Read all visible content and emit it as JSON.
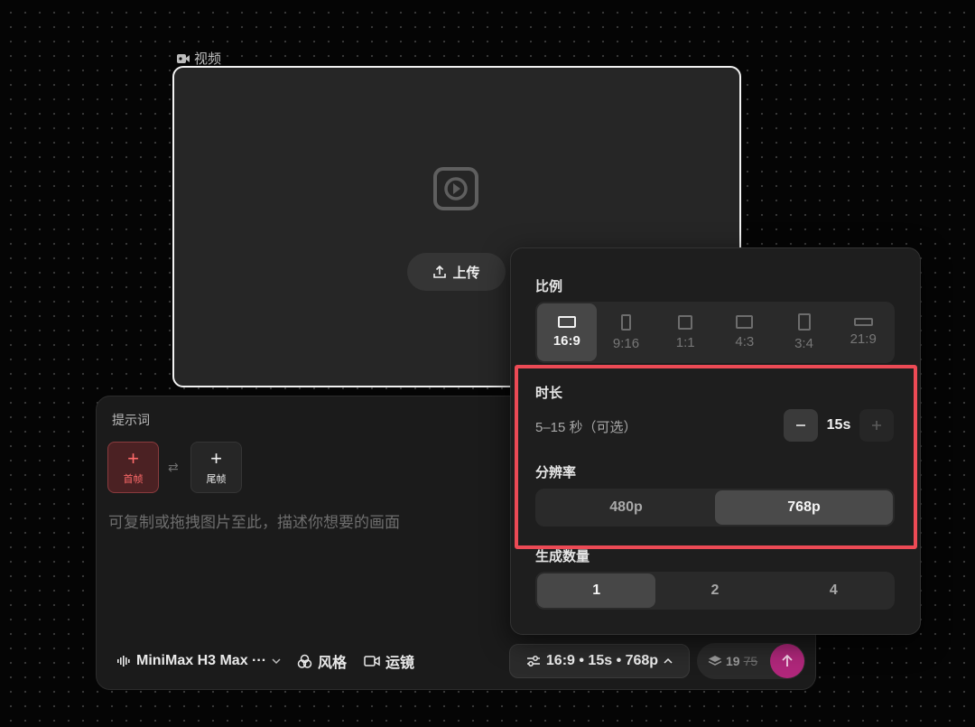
{
  "video": {
    "label": "视频",
    "upload_label": "上传"
  },
  "prompt": {
    "title": "提示词",
    "first_frame": "首帧",
    "last_frame": "尾帧",
    "placeholder": "可复制或拖拽图片至此，描述你想要的画面",
    "model": "MiniMax H3 Max ···",
    "style": "风格",
    "camera": "运镜",
    "settings_summary": "16:9 • 15s • 768p",
    "credits": "19",
    "credits_original": "75"
  },
  "settings": {
    "ratio_title": "比例",
    "ratios": [
      {
        "label": "16:9",
        "active": true
      },
      {
        "label": "9:16",
        "active": false
      },
      {
        "label": "1:1",
        "active": false
      },
      {
        "label": "4:3",
        "active": false
      },
      {
        "label": "3:4",
        "active": false
      },
      {
        "label": "21:9",
        "active": false
      }
    ],
    "duration_title": "时长",
    "duration_hint": "5–15 秒（可选）",
    "duration_value": "15s",
    "resolution_title": "分辨率",
    "resolutions": [
      {
        "label": "480p",
        "active": false
      },
      {
        "label": "768p",
        "active": true
      }
    ],
    "count_title": "生成数量",
    "counts": [
      {
        "label": "1",
        "active": true
      },
      {
        "label": "2",
        "active": false
      },
      {
        "label": "4",
        "active": false
      }
    ]
  },
  "colors": {
    "accent_send": "#b0277b",
    "highlight": "#ec4a55",
    "first_frame": "#ff6a6a"
  }
}
